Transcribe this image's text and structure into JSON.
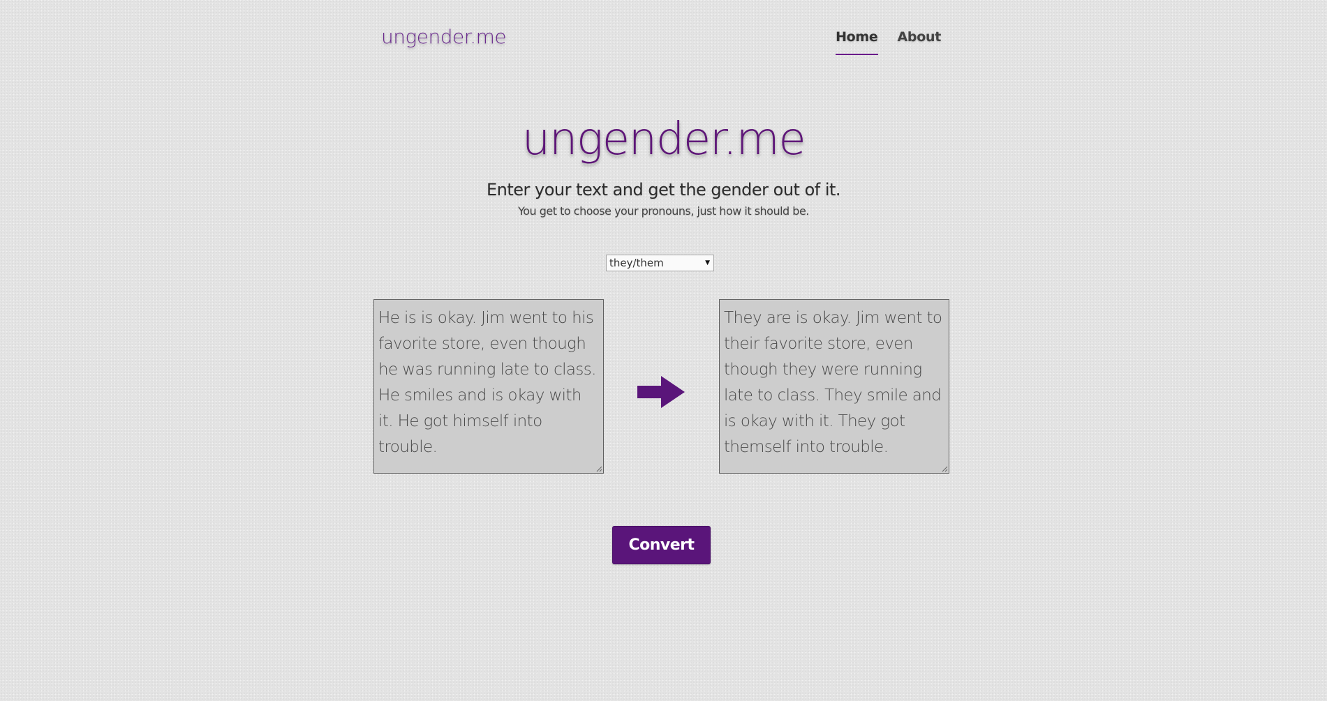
{
  "header": {
    "brand": "ungender.me",
    "nav": [
      {
        "label": "Home",
        "active": true
      },
      {
        "label": "About",
        "active": false
      }
    ]
  },
  "hero": {
    "title": "ungender.me",
    "subtitle": "Enter your text and get the gender out of it.",
    "tagline": "You get to choose your pronouns, just how it should be."
  },
  "pronoun_select": {
    "selected": "they/them"
  },
  "input_text": "He is is okay. Jim went to his favorite store, even though he was running late to class. He smiles and is okay with it. He got himself into trouble.",
  "output_text": "They are is okay. Jim went to their favorite store, even though they were running late to class. They smile and is okay with it. They got themself into trouble.",
  "icons": {
    "arrow": "right-arrow-icon",
    "select_caret": "caret-down-icon"
  },
  "convert_label": "Convert",
  "colors": {
    "accent": "#5a157a",
    "background": "#e3e3e3",
    "textbox": "#cdcdcd"
  }
}
